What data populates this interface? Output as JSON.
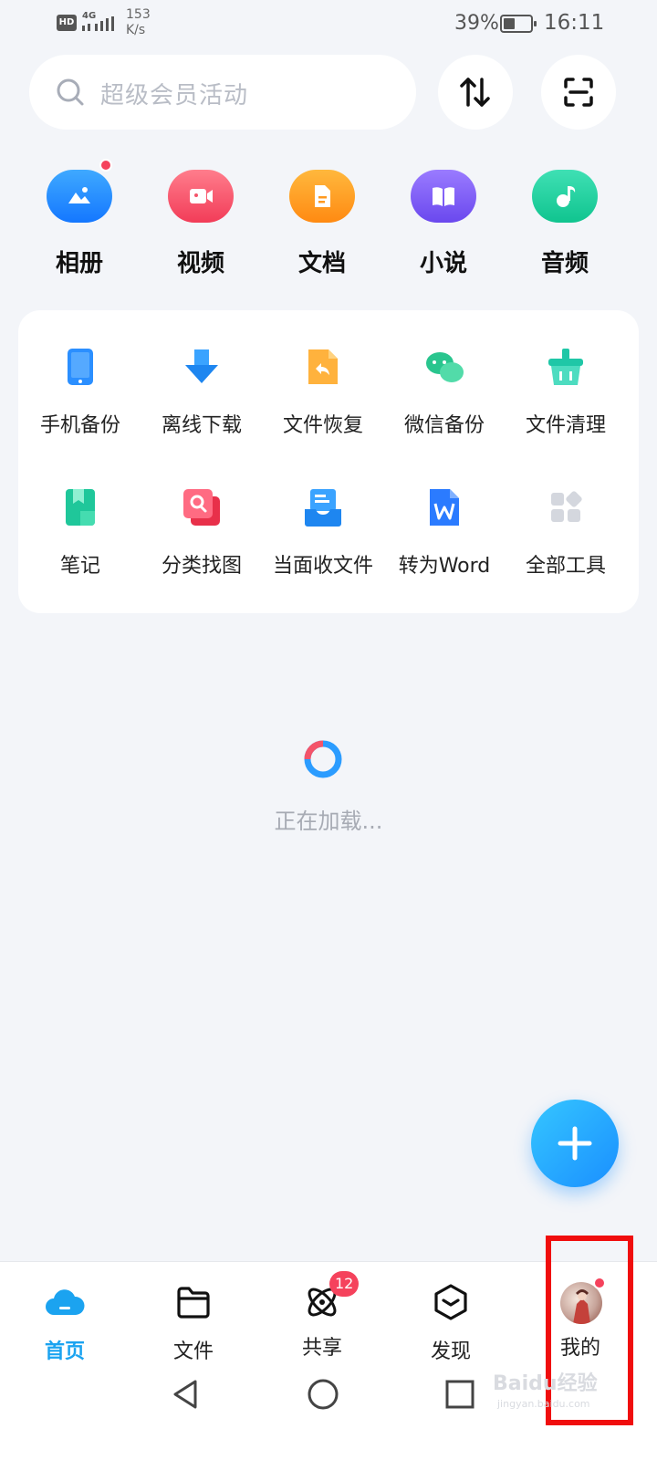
{
  "status_bar": {
    "hd": "HD",
    "network": "4G",
    "speed_value": "153",
    "speed_unit": "K/s",
    "battery_percent": "39%",
    "time": "16:11"
  },
  "search": {
    "placeholder": "超级会员活动"
  },
  "header_buttons": {
    "transfer_icon": "transfer-arrows-icon",
    "scan_icon": "scan-icon"
  },
  "categories": [
    {
      "label": "相册",
      "icon": "photo-album-icon",
      "color": "#1f8fff"
    },
    {
      "label": "视频",
      "icon": "video-icon",
      "color": "#f4546a"
    },
    {
      "label": "文档",
      "icon": "document-icon",
      "color": "#ff9a1f"
    },
    {
      "label": "小说",
      "icon": "book-icon",
      "color": "#7b5cf5"
    },
    {
      "label": "音频",
      "icon": "music-icon",
      "color": "#19cc9a"
    }
  ],
  "tools": [
    {
      "label": "手机备份",
      "icon": "phone-backup-icon"
    },
    {
      "label": "离线下载",
      "icon": "download-icon"
    },
    {
      "label": "文件恢复",
      "icon": "file-restore-icon"
    },
    {
      "label": "微信备份",
      "icon": "wechat-backup-icon"
    },
    {
      "label": "文件清理",
      "icon": "file-clean-icon"
    },
    {
      "label": "笔记",
      "icon": "note-icon"
    },
    {
      "label": "分类找图",
      "icon": "image-search-icon"
    },
    {
      "label": "当面收文件",
      "icon": "receive-file-icon"
    },
    {
      "label": "转为Word",
      "icon": "word-icon"
    },
    {
      "label": "全部工具",
      "icon": "all-tools-icon"
    }
  ],
  "loading_text": "正在加载...",
  "bottom_nav": [
    {
      "label": "首页",
      "icon": "home-cloud-icon",
      "active": true
    },
    {
      "label": "文件",
      "icon": "folder-icon",
      "active": false
    },
    {
      "label": "共享",
      "icon": "share-atom-icon",
      "active": false,
      "badge": "12"
    },
    {
      "label": "发现",
      "icon": "discover-box-icon",
      "active": false
    },
    {
      "label": "我的",
      "icon": "avatar",
      "active": false
    }
  ],
  "watermark": {
    "text": "Baidu经验",
    "sub": "jingyan.baidu.com"
  }
}
